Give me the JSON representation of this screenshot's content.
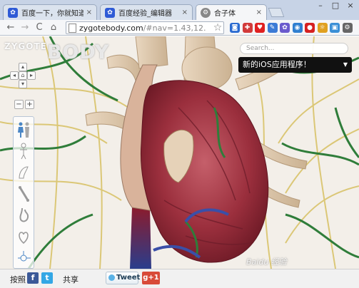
{
  "browser": {
    "tabs": [
      {
        "title": "百度一下，你就知道",
        "favicon": "baidu-paw-icon",
        "active": false
      },
      {
        "title": "百度经验_编辑器",
        "favicon": "baidu-paw-icon",
        "active": false
      },
      {
        "title": "合子体",
        "favicon": "settings-favicon-icon",
        "active": true
      }
    ],
    "tab_close": "×",
    "window_controls": [
      "minimize-icon",
      "maximize-icon",
      "close-icon"
    ],
    "window_glyphs": {
      "minimize": "–",
      "maximize": "□",
      "close": "×"
    },
    "nav": {
      "back": "←",
      "forward": "→",
      "reload": "C",
      "home": "⌂"
    },
    "url": {
      "domain": "zygotebody.com",
      "rest": "/#nav=1.43,12."
    },
    "star": "☆",
    "extensions": [
      {
        "name": "feed-icon",
        "color": "#2a6bd1"
      },
      {
        "name": "extension-icon",
        "color": "#d23a3a"
      },
      {
        "name": "heart-icon",
        "color": "#e02020"
      },
      {
        "name": "chat-icon",
        "color": "#3c7bd6"
      },
      {
        "name": "pinwheel-icon",
        "color": "#6a5acd"
      },
      {
        "name": "camera-icon",
        "color": "#2f7fd0"
      },
      {
        "name": "stop-icon",
        "color": "#d62020"
      },
      {
        "name": "weather-icon",
        "color": "#e0a020"
      },
      {
        "name": "save-icon",
        "color": "#3a8fd6"
      },
      {
        "name": "settings-icon",
        "color": "#666666"
      }
    ]
  },
  "page": {
    "logo": {
      "small": "ZYGOTE",
      "large": "BODY"
    },
    "search": {
      "placeholder": "Search..."
    },
    "banner": {
      "text": "新的iOS应用程序！",
      "arrow": "▼"
    },
    "dpad": {
      "up": "▴",
      "left": "◂",
      "home": "⌂",
      "right": "▸",
      "down": "▾"
    },
    "zoom": {
      "out": "−",
      "in": "+"
    },
    "layer_icons": [
      "female-figure-icon",
      "skeleton-icon",
      "muscle-icon",
      "bone-icon",
      "stomach-icon",
      "heart-layer-icon",
      "neuron-icon"
    ],
    "watermark": "Baidu 经验"
  },
  "sharebar": {
    "label": "按照",
    "facebook": "f",
    "twitter": "t",
    "share": "共享",
    "tweet": "Tweet",
    "gplus": "g+1"
  },
  "colors": {
    "facebook": "#3b5998",
    "twitter": "#33a7e5",
    "gplus": "#d84a38",
    "banner_bg": "#111111"
  }
}
